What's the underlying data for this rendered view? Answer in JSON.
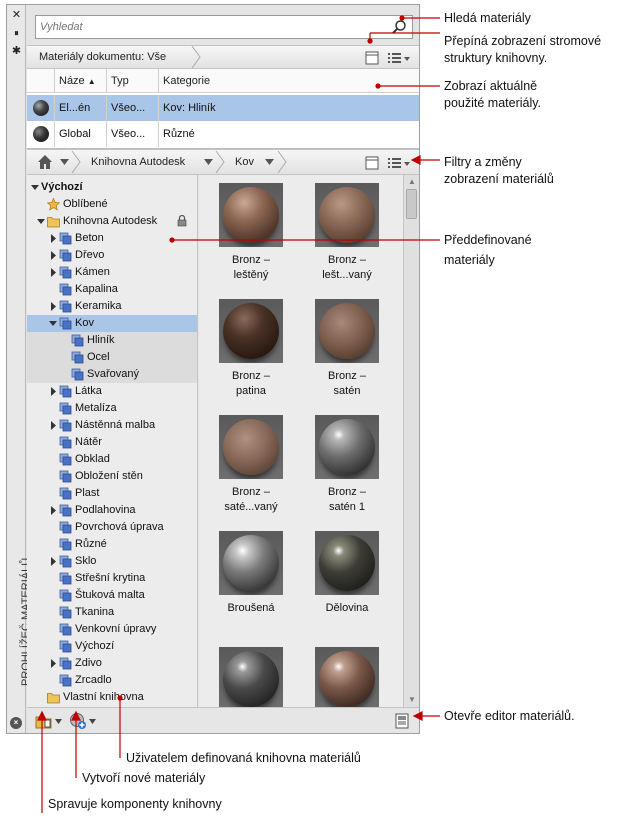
{
  "sidebar": {
    "title": "PROHLÍŽEČ MATERIÁLŮ"
  },
  "search": {
    "placeholder": "Vyhledat"
  },
  "doc_header": {
    "label": "Materiály dokumentu: Vše"
  },
  "doc_table": {
    "columns": [
      "Náze",
      "Typ",
      "Kategorie"
    ],
    "rows": [
      {
        "name": "El...én",
        "type": "Všeo...",
        "category": "Kov: Hliník"
      },
      {
        "name": "Global",
        "type": "Všeo...",
        "category": "Různé"
      }
    ]
  },
  "lib_header": {
    "crumbs": [
      "Knihovna Autodesk",
      "Kov"
    ]
  },
  "tree": {
    "items": [
      {
        "label": "Výchozí"
      },
      {
        "label": "Oblíbené"
      },
      {
        "label": "Knihovna Autodesk"
      },
      {
        "label": "Beton"
      },
      {
        "label": "Dřevo"
      },
      {
        "label": "Kámen"
      },
      {
        "label": "Kapalina"
      },
      {
        "label": "Keramika"
      },
      {
        "label": "Kov"
      },
      {
        "label": "Hliník"
      },
      {
        "label": "Ocel"
      },
      {
        "label": "Svařovaný"
      },
      {
        "label": "Látka"
      },
      {
        "label": "Metalíza"
      },
      {
        "label": "Nástěnná malba"
      },
      {
        "label": "Nátěr"
      },
      {
        "label": "Obklad"
      },
      {
        "label": "Obložení stěn"
      },
      {
        "label": "Plast"
      },
      {
        "label": "Podlahovina"
      },
      {
        "label": "Povrchová úprava"
      },
      {
        "label": "Různé"
      },
      {
        "label": "Sklo"
      },
      {
        "label": "Střešní krytina"
      },
      {
        "label": "Štuková malta"
      },
      {
        "label": "Tkanina"
      },
      {
        "label": "Venkovní úpravy"
      },
      {
        "label": "Výchozí"
      },
      {
        "label": "Zdivo"
      },
      {
        "label": "Zrcadlo"
      },
      {
        "label": "Vlastní knihovna"
      }
    ]
  },
  "thumbnails": [
    {
      "line1": "Bronz –",
      "line2": "leštěný"
    },
    {
      "line1": "Bronz –",
      "line2": "lešt...vaný"
    },
    {
      "line1": "Bronz –",
      "line2": "patina"
    },
    {
      "line1": "Bronz –",
      "line2": "satén"
    },
    {
      "line1": "Bronz –",
      "line2": "saté...vaný"
    },
    {
      "line1": "Bronz –",
      "line2": "satén 1"
    },
    {
      "line1": "Broušená",
      "line2": ""
    },
    {
      "line1": "Dělovina",
      "line2": ""
    },
    {
      "line1": "",
      "line2": ""
    },
    {
      "line1": "",
      "line2": ""
    }
  ],
  "callouts": {
    "search": "Hledá materiály",
    "toggle1": "Přepíná zobrazení stromové",
    "toggle2": "struktury knihovny.",
    "current1": "Zobrazí aktuálně",
    "current2": "použité materiály.",
    "filters1": "Filtry a změny",
    "filters2": "zobrazení materiálů",
    "predef1": "Předdefinované",
    "predef2": "materiály",
    "editor": "Otevře editor materiálů.",
    "userlib": "Uživatelem definovaná knihovna materiálů",
    "create": "Vytvoří nové materiály",
    "manage": "Spravuje komponenty knihovny"
  }
}
